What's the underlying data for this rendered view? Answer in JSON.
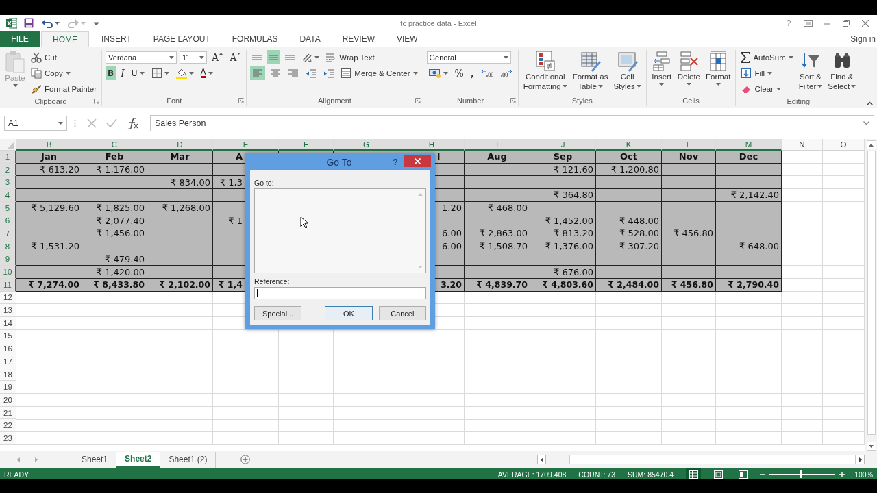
{
  "title_bar": {
    "title": "tc practice data - Excel",
    "help": "?"
  },
  "ribbon_tabs": [
    {
      "label": "FILE",
      "kind": "file",
      "selected": false
    },
    {
      "label": "HOME",
      "kind": "tab",
      "selected": true
    },
    {
      "label": "INSERT",
      "kind": "tab",
      "selected": false
    },
    {
      "label": "PAGE LAYOUT",
      "kind": "tab",
      "selected": false
    },
    {
      "label": "FORMULAS",
      "kind": "tab",
      "selected": false
    },
    {
      "label": "DATA",
      "kind": "tab",
      "selected": false
    },
    {
      "label": "REVIEW",
      "kind": "tab",
      "selected": false
    },
    {
      "label": "VIEW",
      "kind": "tab",
      "selected": false
    }
  ],
  "account": "Sign in",
  "ribbon_groups": [
    {
      "label": "Clipboard",
      "launcher": true,
      "blocks": [
        {
          "kind": "large",
          "lines": [
            "Paste"
          ],
          "dropdown": true,
          "disabled": true
        },
        {
          "kind": "stack",
          "lines": [
            {
              "controls": [
                {
                  "kind": "small",
                  "label": "Cut",
                  "dropdown": false
                }
              ]
            },
            {
              "controls": [
                {
                  "kind": "small",
                  "label": "Copy",
                  "dropdown": true
                }
              ]
            },
            {
              "controls": [
                {
                  "kind": "small",
                  "label": "Format Painter",
                  "dropdown": false
                }
              ]
            }
          ]
        }
      ]
    },
    {
      "label": "Font",
      "launcher": true,
      "blocks": [
        {
          "kind": "stack",
          "lines": [
            {
              "controls": [
                {
                  "kind": "combo",
                  "value": "Verdana"
                },
                {
                  "kind": "combo",
                  "value": "11"
                },
                {
                  "kind": "glyph",
                  "text": "A",
                  "dropdown": false
                },
                {
                  "kind": "glyph",
                  "text": "A",
                  "dropdown": false
                }
              ]
            },
            {
              "controls": [
                {
                  "kind": "glyph",
                  "text": "B",
                  "selected": true,
                  "dropdown": false
                },
                {
                  "kind": "glyph",
                  "text": "I",
                  "selected": false,
                  "dropdown": false
                },
                {
                  "kind": "glyph",
                  "text": "U",
                  "selected": false,
                  "dropdown": true
                },
                {
                  "kind": "icon",
                  "dropdown": true
                },
                {
                  "kind": "icon",
                  "dropdown": true
                },
                {
                  "kind": "glyph",
                  "text": "A",
                  "dropdown": true
                }
              ]
            }
          ]
        }
      ]
    },
    {
      "label": "Alignment",
      "launcher": true,
      "blocks": [
        {
          "kind": "stack",
          "lines": [
            {
              "controls": [
                {
                  "kind": "icon",
                  "selected": false,
                  "dropdown": false
                },
                {
                  "kind": "icon",
                  "selected": true,
                  "dropdown": false
                },
                {
                  "kind": "icon",
                  "selected": false,
                  "dropdown": false
                },
                {
                  "kind": "icon",
                  "dropdown": true
                },
                {
                  "kind": "small",
                  "label": "Wrap Text",
                  "dropdown": false
                }
              ]
            },
            {
              "controls": [
                {
                  "kind": "icon",
                  "selected": true,
                  "dropdown": false
                },
                {
                  "kind": "icon",
                  "selected": false,
                  "dropdown": false
                },
                {
                  "kind": "icon",
                  "selected": false,
                  "dropdown": false
                },
                {
                  "kind": "icon",
                  "dropdown": false
                },
                {
                  "kind": "icon",
                  "dropdown": false
                },
                {
                  "kind": "small",
                  "label": "Merge & Center",
                  "dropdown": true
                }
              ]
            }
          ]
        }
      ]
    },
    {
      "label": "Number",
      "launcher": true,
      "blocks": [
        {
          "kind": "stack",
          "lines": [
            {
              "controls": [
                {
                  "kind": "combo",
                  "value": "General"
                }
              ]
            },
            {
              "controls": [
                {
                  "kind": "icon",
                  "dropdown": true
                },
                {
                  "kind": "glyph",
                  "text": "%",
                  "dropdown": false
                },
                {
                  "kind": "glyph",
                  "text": ",",
                  "dropdown": false
                },
                {
                  "kind": "icon",
                  "dropdown": false
                },
                {
                  "kind": "icon",
                  "dropdown": false
                }
              ]
            }
          ]
        }
      ]
    },
    {
      "label": "Styles",
      "launcher": false,
      "blocks": [
        {
          "kind": "large",
          "lines": [
            "Conditional",
            "Formatting"
          ],
          "dropdown": true,
          "disabled": false
        },
        {
          "kind": "large",
          "lines": [
            "Format as",
            "Table"
          ],
          "dropdown": true,
          "disabled": false
        },
        {
          "kind": "large",
          "lines": [
            "Cell",
            "Styles"
          ],
          "dropdown": true,
          "disabled": false
        }
      ]
    },
    {
      "label": "Cells",
      "launcher": false,
      "blocks": [
        {
          "kind": "large",
          "lines": [
            "Insert"
          ],
          "dropdown": true,
          "disabled": false
        },
        {
          "kind": "large",
          "lines": [
            "Delete"
          ],
          "dropdown": true,
          "disabled": false
        },
        {
          "kind": "large",
          "lines": [
            "Format"
          ],
          "dropdown": true,
          "disabled": false
        }
      ]
    },
    {
      "label": "Editing",
      "launcher": false,
      "blocks": [
        {
          "kind": "stack",
          "lines": [
            {
              "controls": [
                {
                  "kind": "small",
                  "label": "AutoSum",
                  "dropdown": true
                }
              ]
            },
            {
              "controls": [
                {
                  "kind": "small",
                  "label": "Fill",
                  "dropdown": true
                }
              ]
            },
            {
              "controls": [
                {
                  "kind": "small",
                  "label": "Clear",
                  "dropdown": true
                }
              ]
            }
          ]
        },
        {
          "kind": "large",
          "lines": [
            "Sort &",
            "Filter"
          ],
          "dropdown": true,
          "disabled": false
        },
        {
          "kind": "large",
          "lines": [
            "Find &",
            "Select"
          ],
          "dropdown": true,
          "disabled": false
        }
      ]
    }
  ],
  "formula_bar": {
    "name_box": "A1",
    "formula": "Sales Person"
  },
  "table": {
    "columns": [
      {
        "label": "B",
        "selected": true
      },
      {
        "label": "C",
        "selected": true
      },
      {
        "label": "D",
        "selected": true
      },
      {
        "label": "E",
        "selected": true
      },
      {
        "label": "F",
        "selected": true
      },
      {
        "label": "G",
        "selected": true
      },
      {
        "label": "H",
        "selected": true
      },
      {
        "label": "I",
        "selected": true
      },
      {
        "label": "J",
        "selected": true
      },
      {
        "label": "K",
        "selected": true
      },
      {
        "label": "L",
        "selected": true
      },
      {
        "label": "M",
        "selected": true
      },
      {
        "label": "N",
        "selected": false
      },
      {
        "label": "O",
        "selected": false
      }
    ],
    "rows": [
      {
        "header": "1",
        "kind": "heading",
        "selected": true,
        "cells": {
          "B": "Jan",
          "C": "Feb",
          "D": "Mar",
          "E": "A",
          "H": "l",
          "I": "Aug",
          "J": "Sep",
          "K": "Oct",
          "L": "Nov",
          "M": "Dec"
        }
      },
      {
        "header": "2",
        "kind": "data",
        "selected": true,
        "cells": {
          "B": "₹ 613.20",
          "C": "₹ 1,176.00",
          "J": "₹ 121.60",
          "K": "₹ 1,200.80"
        }
      },
      {
        "header": "3",
        "kind": "data",
        "selected": true,
        "cells": {
          "D": "₹ 834.00",
          "E": "₹ 1,3"
        }
      },
      {
        "header": "4",
        "kind": "data",
        "selected": true,
        "cells": {
          "J": "₹ 364.80",
          "M": "₹ 2,142.40"
        }
      },
      {
        "header": "5",
        "kind": "data",
        "selected": true,
        "cells": {
          "B": "₹ 5,129.60",
          "C": "₹ 1,825.00",
          "D": "₹ 1,268.00",
          "H": "1.20",
          "I": "₹ 468.00"
        }
      },
      {
        "header": "6",
        "kind": "data",
        "selected": true,
        "cells": {
          "C": "₹ 2,077.40",
          "E": "₹ 1",
          "J": "₹ 1,452.00",
          "K": "₹ 448.00"
        }
      },
      {
        "header": "7",
        "kind": "data",
        "selected": true,
        "cells": {
          "C": "₹ 1,456.00",
          "H": "6.00",
          "I": "₹ 2,863.00",
          "J": "₹ 813.20",
          "K": "₹ 528.00",
          "L": "₹ 456.80"
        }
      },
      {
        "header": "8",
        "kind": "data",
        "selected": true,
        "cells": {
          "B": "₹ 1,531.20",
          "H": "6.00",
          "I": "₹ 1,508.70",
          "J": "₹ 1,376.00",
          "K": "₹ 307.20",
          "M": "₹ 648.00"
        }
      },
      {
        "header": "9",
        "kind": "data",
        "selected": true,
        "cells": {
          "C": "₹ 479.40"
        }
      },
      {
        "header": "10",
        "kind": "data",
        "selected": true,
        "cells": {
          "C": "₹ 1,420.00",
          "J": "₹ 676.00"
        }
      },
      {
        "header": "11",
        "kind": "total",
        "selected": true,
        "cells": {
          "B": "₹ 7,274.00",
          "C": "₹ 8,433.80",
          "D": "₹ 2,102.00",
          "E": "₹ 1,4",
          "H": "3.20",
          "I": "₹ 4,839.70",
          "J": "₹ 4,803.60",
          "K": "₹ 2,484.00",
          "L": "₹ 456.80",
          "M": "₹ 2,790.40"
        }
      },
      {
        "header": "12",
        "kind": "blank",
        "selected": false
      },
      {
        "header": "13",
        "kind": "blank",
        "selected": false
      },
      {
        "header": "14",
        "kind": "blank",
        "selected": false
      },
      {
        "header": "15",
        "kind": "blank",
        "selected": false
      },
      {
        "header": "16",
        "kind": "blank",
        "selected": false
      },
      {
        "header": "17",
        "kind": "blank",
        "selected": false
      },
      {
        "header": "18",
        "kind": "blank",
        "selected": false
      },
      {
        "header": "19",
        "kind": "blank",
        "selected": false
      },
      {
        "header": "20",
        "kind": "blank",
        "selected": false
      },
      {
        "header": "21",
        "kind": "blank",
        "selected": false
      },
      {
        "header": "22",
        "kind": "blank",
        "selected": false
      },
      {
        "header": "23",
        "kind": "blank",
        "selected": false
      }
    ]
  },
  "dialog": {
    "title": "Go To",
    "help": "?",
    "list_label": "Go to:",
    "reference_label": "Reference:",
    "buttons": [
      {
        "label": "Special...",
        "default": false
      },
      {
        "label": "OK",
        "default": true
      },
      {
        "label": "Cancel",
        "default": false
      }
    ]
  },
  "sheet_tabs": [
    {
      "label": "Sheet1",
      "selected": false
    },
    {
      "label": "Sheet2",
      "selected": true
    },
    {
      "label": "Sheet1 (2)",
      "selected": false
    }
  ],
  "status_bar": {
    "mode": "READY",
    "stats": [
      "AVERAGE: 1709.408",
      "COUNT: 73",
      "SUM: 85470.4"
    ],
    "views": [
      {
        "selected": true
      },
      {
        "selected": false
      },
      {
        "selected": false
      }
    ],
    "zoom": {
      "level": 0.48,
      "reading": "100%"
    }
  }
}
